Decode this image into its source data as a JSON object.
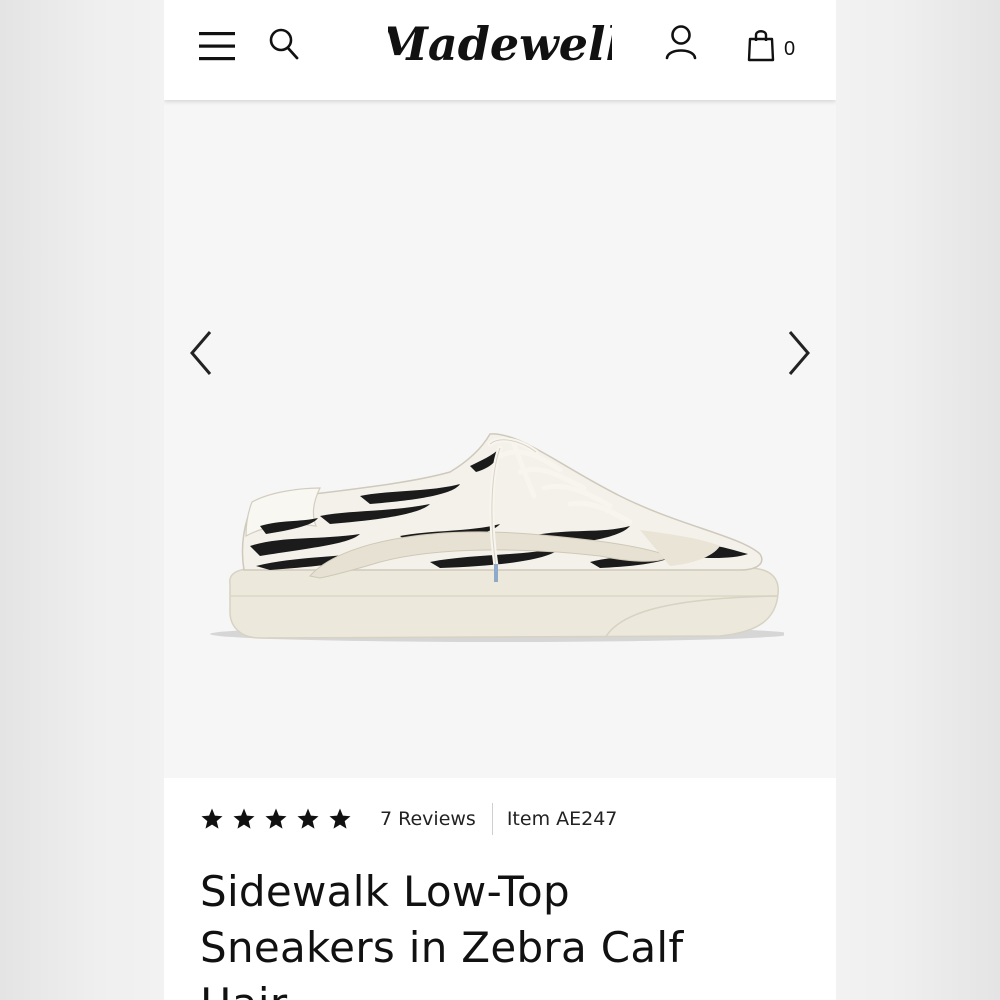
{
  "header": {
    "logo_text": "Madewell",
    "bag_count": "0",
    "icons": [
      "menu-icon",
      "search-icon",
      "account-icon",
      "shopping-bag-icon"
    ]
  },
  "gallery": {
    "prev_icon": "chevron-left-icon",
    "next_icon": "chevron-right-icon",
    "image": "zebra-calf-hair-low-top-sneaker"
  },
  "product": {
    "rating": 5,
    "rating_max": 5,
    "reviews_label": "7 Reviews",
    "item_label": "Item AE247",
    "title": "Sidewalk Low-Top Sneakers in Zebra Calf Hair"
  },
  "colors": {
    "header_bg": "#ffffff",
    "page_bg": "#f6f6f6",
    "text": "#111111"
  }
}
